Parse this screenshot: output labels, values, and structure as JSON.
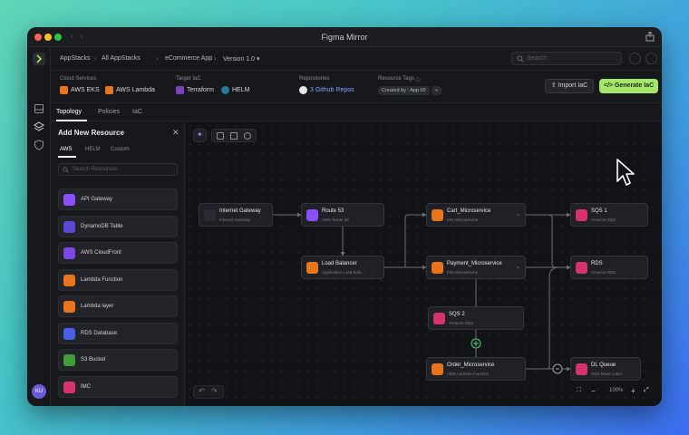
{
  "window": {
    "title": "Figma Mirror"
  },
  "nav": {
    "breadcrumbs": [
      "AppStacks",
      "All AppStacks",
      "eCommerce App"
    ],
    "version": "Version 1.0",
    "search_placeholder": "Search"
  },
  "info": {
    "cloud_services_label": "Cloud Services",
    "cloud_services": [
      "AWS EKS",
      "AWS Lambda"
    ],
    "target_iac_label": "Target IaC",
    "target_iac": [
      "Terraform",
      "HELM"
    ],
    "repositories_label": "Repositories",
    "repositories": "3 Github Repos",
    "resource_tags_label": "Resource Tags",
    "tag_chip": "Created by : App 00",
    "tag_more": "+",
    "import_label": "Import IaC",
    "generate_label": "Generate IaC",
    "more_label": "⋮"
  },
  "tabs": [
    {
      "label": "Topology"
    },
    {
      "label": "Policies"
    },
    {
      "label": "IaC"
    }
  ],
  "panel": {
    "title": "Add New Resource",
    "close": "✕",
    "tabs": [
      "AWS",
      "HELM",
      "Custom"
    ],
    "search_placeholder": "Search Resources",
    "items": [
      {
        "label": "API Gateway",
        "icon": "api-gateway-icon",
        "color": "#8c4fff"
      },
      {
        "label": "DynamoDB Table",
        "icon": "dynamodb-icon",
        "color": "#5a48d6"
      },
      {
        "label": "AWS CloudFront",
        "icon": "cloudfront-icon",
        "color": "#7b47e8"
      },
      {
        "label": "Lambda Function",
        "icon": "lambda-icon",
        "color": "#e8741c"
      },
      {
        "label": "Lambda layer",
        "icon": "lambda-layer-icon",
        "color": "#e8741c"
      },
      {
        "label": "RDS Database",
        "icon": "rds-icon",
        "color": "#4a5ee8"
      },
      {
        "label": "S3 Bucket",
        "icon": "s3-icon",
        "color": "#3f9e3a"
      },
      {
        "label": "IMC",
        "icon": "imc-icon",
        "color": "#d6336c"
      }
    ]
  },
  "canvas": {
    "zoom": "100%",
    "nodes": {
      "internet_gateway": {
        "name": "Internet Gateway",
        "sub": "Internet Gateway",
        "color": "#2a2c33"
      },
      "route53": {
        "name": "Route 53",
        "sub": "AWS Route 53",
        "color": "#8c4fff"
      },
      "load_balancer": {
        "name": "Load Balancer",
        "sub": "Application Load Bala...",
        "color": "#e8741c"
      },
      "cart": {
        "name": "Cart_Microservice",
        "sub": "K8s Microservice",
        "color": "#e8741c"
      },
      "payment": {
        "name": "Payment_Microservice",
        "sub": "K8s Microservice",
        "color": "#e8741c"
      },
      "sqs1": {
        "name": "SQS 1",
        "sub": "Amazon SQS",
        "color": "#d6336c"
      },
      "rds": {
        "name": "RDS",
        "sub": "Amazon RDS",
        "color": "#d6336c"
      },
      "sqs2": {
        "name": "SQS 2",
        "sub": "Amazon SQS",
        "color": "#d6336c"
      },
      "order": {
        "name": "Order_Microservice",
        "sub": "AWS Lambda Function",
        "color": "#e8741c"
      },
      "dl_queue": {
        "name": "DL Queue",
        "sub": "SQS Dead Letter",
        "color": "#d6336c"
      }
    },
    "colors": {
      "accent_green": "#a6e66a",
      "edge": "#6b6e77",
      "plus_green": "#44d17a"
    }
  }
}
